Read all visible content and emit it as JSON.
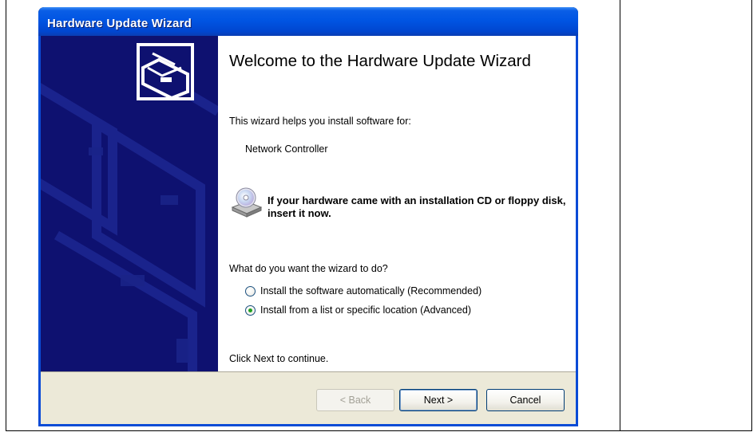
{
  "window": {
    "title": "Hardware Update Wizard"
  },
  "content": {
    "heading": "Welcome to the Hardware Update Wizard",
    "intro": "This wizard helps you install software for:",
    "device": "Network Controller",
    "cd_prompt": "If your hardware came with an installation CD or floppy disk, insert it now.",
    "question": "What do you want the wizard to do?",
    "options": [
      {
        "label": "Install the software automatically (Recommended)",
        "selected": false
      },
      {
        "label": "Install from a list or specific location (Advanced)",
        "selected": true
      }
    ],
    "footer": "Click Next to continue."
  },
  "buttons": {
    "back": "< Back",
    "next": "Next >",
    "cancel": "Cancel"
  },
  "colors": {
    "titlebar": "#0055e3",
    "left_panel": "#0e1170",
    "selected_radio": "#21a121"
  },
  "icons": {
    "wizard_graphic": "hardware-card-icon",
    "cd": "cd-drive-icon"
  }
}
